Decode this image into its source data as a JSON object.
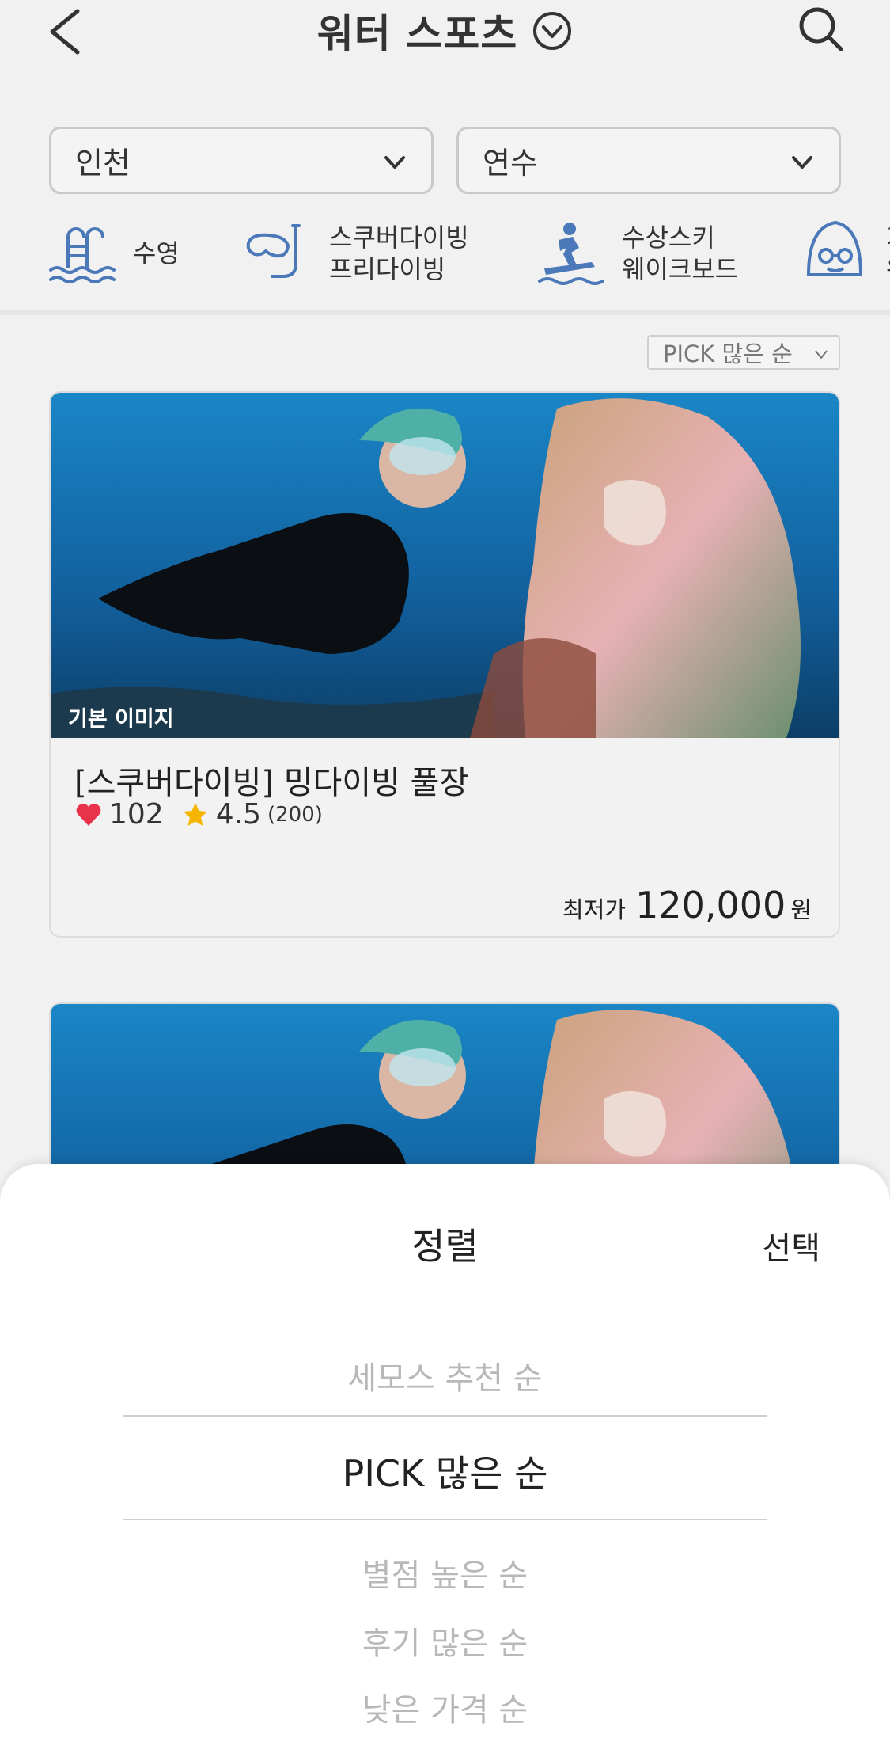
{
  "header": {
    "title": "워터 스포츠"
  },
  "filters": {
    "city": "인천",
    "district": "연수"
  },
  "categories": [
    {
      "lines": [
        "수영"
      ],
      "icon": "swimming-ladder-icon"
    },
    {
      "lines": [
        "스쿠버다이빙",
        "프리다이빙"
      ],
      "icon": "snorkel-mask-icon"
    },
    {
      "lines": [
        "수상스키",
        "웨이크보드"
      ],
      "icon": "water-ski-icon"
    },
    {
      "lines": [
        "기",
        "워"
      ],
      "icon": "swim-cap-icon"
    }
  ],
  "sort_chip": "PICK 많은 순",
  "cards": [
    {
      "tag": "기본 이미지",
      "title": "[스쿠버다이빙] 밍다이빙 풀장",
      "likes": "102",
      "rating": "4.5",
      "reviews": "(200)",
      "price_label": "최저가",
      "price": "120,000",
      "price_unit": "원"
    },
    {
      "tag": "",
      "title": ""
    }
  ],
  "sort_sheet": {
    "title": "정렬",
    "select_label": "선택",
    "options": [
      "세모스 추천 순",
      "PICK 많은 순",
      "별점 높은 순",
      "후기 많은 순",
      "낮은 가격 순"
    ],
    "selected_index": 1
  },
  "colors": {
    "accent_blue": "#4a78b8",
    "heart": "#e8334a",
    "star": "#f5b400"
  }
}
